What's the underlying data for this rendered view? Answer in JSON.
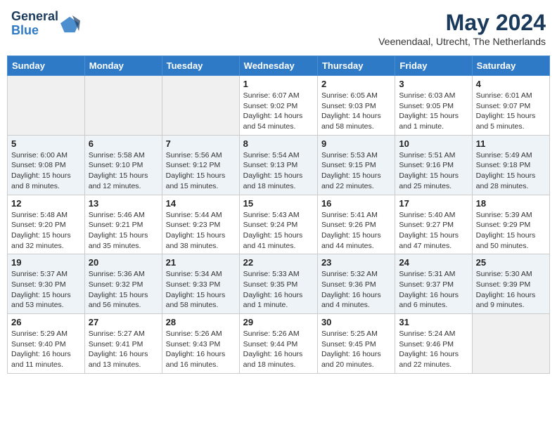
{
  "header": {
    "logo_general": "General",
    "logo_blue": "Blue",
    "month_year": "May 2024",
    "location": "Veenendaal, Utrecht, The Netherlands"
  },
  "weekdays": [
    "Sunday",
    "Monday",
    "Tuesday",
    "Wednesday",
    "Thursday",
    "Friday",
    "Saturday"
  ],
  "weeks": [
    [
      {
        "day": "",
        "info": ""
      },
      {
        "day": "",
        "info": ""
      },
      {
        "day": "",
        "info": ""
      },
      {
        "day": "1",
        "info": "Sunrise: 6:07 AM\nSunset: 9:02 PM\nDaylight: 14 hours\nand 54 minutes."
      },
      {
        "day": "2",
        "info": "Sunrise: 6:05 AM\nSunset: 9:03 PM\nDaylight: 14 hours\nand 58 minutes."
      },
      {
        "day": "3",
        "info": "Sunrise: 6:03 AM\nSunset: 9:05 PM\nDaylight: 15 hours\nand 1 minute."
      },
      {
        "day": "4",
        "info": "Sunrise: 6:01 AM\nSunset: 9:07 PM\nDaylight: 15 hours\nand 5 minutes."
      }
    ],
    [
      {
        "day": "5",
        "info": "Sunrise: 6:00 AM\nSunset: 9:08 PM\nDaylight: 15 hours\nand 8 minutes."
      },
      {
        "day": "6",
        "info": "Sunrise: 5:58 AM\nSunset: 9:10 PM\nDaylight: 15 hours\nand 12 minutes."
      },
      {
        "day": "7",
        "info": "Sunrise: 5:56 AM\nSunset: 9:12 PM\nDaylight: 15 hours\nand 15 minutes."
      },
      {
        "day": "8",
        "info": "Sunrise: 5:54 AM\nSunset: 9:13 PM\nDaylight: 15 hours\nand 18 minutes."
      },
      {
        "day": "9",
        "info": "Sunrise: 5:53 AM\nSunset: 9:15 PM\nDaylight: 15 hours\nand 22 minutes."
      },
      {
        "day": "10",
        "info": "Sunrise: 5:51 AM\nSunset: 9:16 PM\nDaylight: 15 hours\nand 25 minutes."
      },
      {
        "day": "11",
        "info": "Sunrise: 5:49 AM\nSunset: 9:18 PM\nDaylight: 15 hours\nand 28 minutes."
      }
    ],
    [
      {
        "day": "12",
        "info": "Sunrise: 5:48 AM\nSunset: 9:20 PM\nDaylight: 15 hours\nand 32 minutes."
      },
      {
        "day": "13",
        "info": "Sunrise: 5:46 AM\nSunset: 9:21 PM\nDaylight: 15 hours\nand 35 minutes."
      },
      {
        "day": "14",
        "info": "Sunrise: 5:44 AM\nSunset: 9:23 PM\nDaylight: 15 hours\nand 38 minutes."
      },
      {
        "day": "15",
        "info": "Sunrise: 5:43 AM\nSunset: 9:24 PM\nDaylight: 15 hours\nand 41 minutes."
      },
      {
        "day": "16",
        "info": "Sunrise: 5:41 AM\nSunset: 9:26 PM\nDaylight: 15 hours\nand 44 minutes."
      },
      {
        "day": "17",
        "info": "Sunrise: 5:40 AM\nSunset: 9:27 PM\nDaylight: 15 hours\nand 47 minutes."
      },
      {
        "day": "18",
        "info": "Sunrise: 5:39 AM\nSunset: 9:29 PM\nDaylight: 15 hours\nand 50 minutes."
      }
    ],
    [
      {
        "day": "19",
        "info": "Sunrise: 5:37 AM\nSunset: 9:30 PM\nDaylight: 15 hours\nand 53 minutes."
      },
      {
        "day": "20",
        "info": "Sunrise: 5:36 AM\nSunset: 9:32 PM\nDaylight: 15 hours\nand 56 minutes."
      },
      {
        "day": "21",
        "info": "Sunrise: 5:34 AM\nSunset: 9:33 PM\nDaylight: 15 hours\nand 58 minutes."
      },
      {
        "day": "22",
        "info": "Sunrise: 5:33 AM\nSunset: 9:35 PM\nDaylight: 16 hours\nand 1 minute."
      },
      {
        "day": "23",
        "info": "Sunrise: 5:32 AM\nSunset: 9:36 PM\nDaylight: 16 hours\nand 4 minutes."
      },
      {
        "day": "24",
        "info": "Sunrise: 5:31 AM\nSunset: 9:37 PM\nDaylight: 16 hours\nand 6 minutes."
      },
      {
        "day": "25",
        "info": "Sunrise: 5:30 AM\nSunset: 9:39 PM\nDaylight: 16 hours\nand 9 minutes."
      }
    ],
    [
      {
        "day": "26",
        "info": "Sunrise: 5:29 AM\nSunset: 9:40 PM\nDaylight: 16 hours\nand 11 minutes."
      },
      {
        "day": "27",
        "info": "Sunrise: 5:27 AM\nSunset: 9:41 PM\nDaylight: 16 hours\nand 13 minutes."
      },
      {
        "day": "28",
        "info": "Sunrise: 5:26 AM\nSunset: 9:43 PM\nDaylight: 16 hours\nand 16 minutes."
      },
      {
        "day": "29",
        "info": "Sunrise: 5:26 AM\nSunset: 9:44 PM\nDaylight: 16 hours\nand 18 minutes."
      },
      {
        "day": "30",
        "info": "Sunrise: 5:25 AM\nSunset: 9:45 PM\nDaylight: 16 hours\nand 20 minutes."
      },
      {
        "day": "31",
        "info": "Sunrise: 5:24 AM\nSunset: 9:46 PM\nDaylight: 16 hours\nand 22 minutes."
      },
      {
        "day": "",
        "info": ""
      }
    ]
  ]
}
